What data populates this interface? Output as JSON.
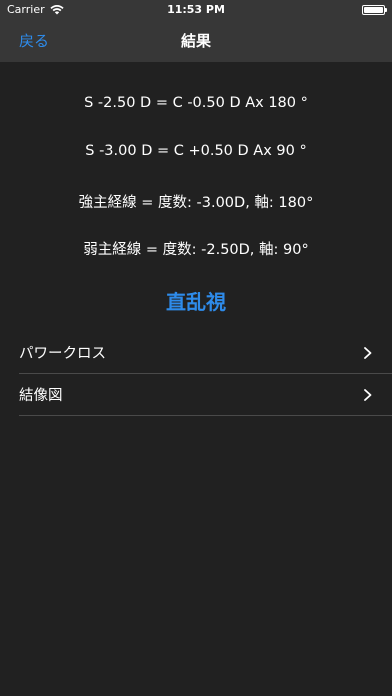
{
  "status_bar": {
    "carrier": "Carrier",
    "time": "11:53 PM"
  },
  "nav": {
    "back_label": "戻る",
    "title": "結果"
  },
  "results": {
    "line1": "S -2.50 D = C -0.50 D Ax 180 °",
    "line2": "S -3.00 D = C +0.50 D Ax 90 °",
    "line3": "強主経線 = 度数: -3.00D, 軸: 180°",
    "line4": "弱主経線 = 度数: -2.50D, 軸: 90°"
  },
  "diagnosis": "直乱視",
  "list": {
    "items": [
      {
        "label": "パワークロス"
      },
      {
        "label": "結像図"
      }
    ]
  },
  "colors": {
    "background": "#212121",
    "bar": "#373737",
    "accent": "#2e8bea",
    "separator": "#4a4a4a"
  },
  "icons": [
    "wifi-icon",
    "battery-icon",
    "chevron-right-icon"
  ]
}
